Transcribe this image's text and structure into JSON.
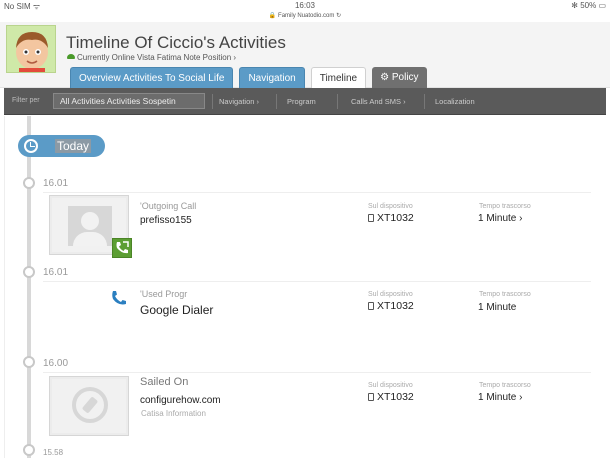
{
  "status_bar": {
    "carrier": "No SIM ᯤ",
    "time": "16:03",
    "battery": "✻ 50% ▭",
    "url": "🔒 Family Nuatodio.com ↻"
  },
  "header": {
    "title": "Timeline Of Ciccio's Activities",
    "subtitle": "Currently Online Vista Fatima Note Position ›"
  },
  "tabs": [
    {
      "label": "Overview Activities To Social Life"
    },
    {
      "label": "Navigation"
    },
    {
      "label": "Timeline"
    },
    {
      "label": "⚙ Policy"
    }
  ],
  "filter": {
    "label": "Filter per",
    "selected": "All Activities Activities Sospetin",
    "items": [
      "Navigation ›",
      "Program",
      "Calls And SMS ›",
      "Localization"
    ]
  },
  "today_label": "Today",
  "events": [
    {
      "time": "16.01",
      "type_label": "'Outgoing Call",
      "value": "prefisso155",
      "device_label": "Sul dispositivo",
      "device": "XT1032",
      "duration_label": "Tempo trascorso",
      "duration": "1 Minute ›"
    },
    {
      "time": "16.01",
      "type_label": "'Used Progr",
      "value": "Google Dialer",
      "device_label": "Sul dispositivo",
      "device": "XT1032",
      "duration_label": "Tempo trascorso",
      "duration": "1 Minute"
    },
    {
      "time": "16.00",
      "type_label": "Sailed On",
      "value": "configurehow.com",
      "sub": "Catisa Information",
      "device_label": "Sul dispositivo",
      "device": "XT1032",
      "duration_label": "Tempo trascorso",
      "duration": "1 Minute ›"
    },
    {
      "time": "15.58"
    }
  ],
  "colors": {
    "accent_blue": "#5b9bc7",
    "filter_bar": "#5a5a5a",
    "call_badge": "#5c9e33",
    "phone_icon": "#2b7fc0"
  }
}
